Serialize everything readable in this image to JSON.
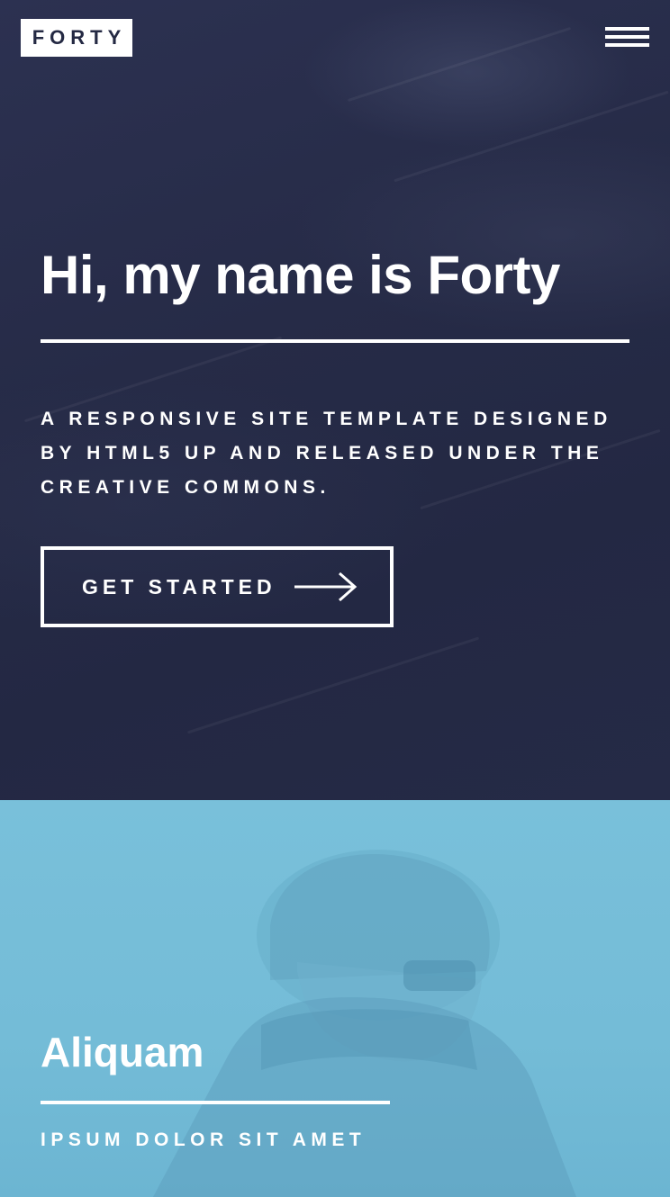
{
  "header": {
    "logo_text": "FORTY",
    "menu_icon": "hamburger-menu-icon"
  },
  "banner": {
    "title": "Hi, my name is Forty",
    "subtitle": "A responsive site template designed by HTML5 UP and released under the Creative Commons.",
    "cta_label": "Get Started",
    "cta_icon": "arrow-right-icon"
  },
  "tiles": [
    {
      "title": "Aliquam",
      "subtitle": "ipsum dolor sit amet",
      "color": "#6fc3df"
    }
  ],
  "colors": {
    "background": "#242943",
    "accent": "#ffffff"
  }
}
